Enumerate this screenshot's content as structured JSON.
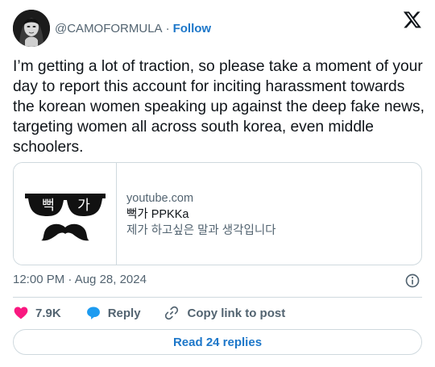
{
  "author": {
    "handle": "@CAMOFORMULA",
    "separator": "·",
    "follow_label": "Follow"
  },
  "platform_icon": "x-logo-icon",
  "tweet": {
    "text": "I’m getting a lot of traction, so please take a moment of your day to report this account for inciting harassment towards the korean women speaking up against the deep fake news, targeting women all across south korea, even middle schoolers."
  },
  "link_card": {
    "thumbnail_text": [
      "뻑",
      "가"
    ],
    "domain": "youtube.com",
    "title": "뻑가 PPKKa",
    "description": "제가 하고싶은 말과 생각입니다"
  },
  "timestamp": "12:00 PM · Aug 28, 2024",
  "actions": {
    "like_count": "7.9K",
    "reply_label": "Reply",
    "copy_label": "Copy link to post"
  },
  "read_replies_label": "Read 24 replies",
  "colors": {
    "accent": "#1d77c9",
    "like": "#f91880",
    "reply": "#1d9bf0",
    "muted": "#536471",
    "border": "#cfd9de"
  }
}
